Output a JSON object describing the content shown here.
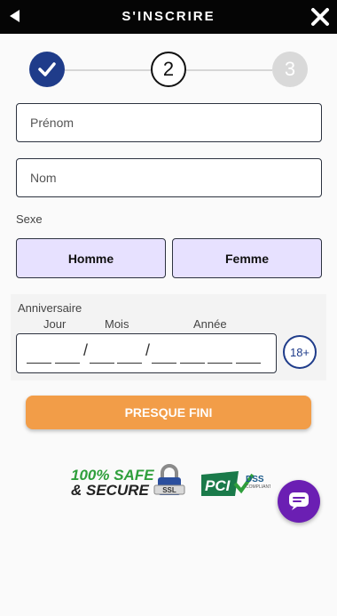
{
  "header": {
    "title": "S'INSCRIRE"
  },
  "steps": {
    "step2": "2",
    "step3": "3"
  },
  "form": {
    "first_name_placeholder": "Prénom",
    "last_name_placeholder": "Nom",
    "sex_label": "Sexe",
    "male_label": "Homme",
    "female_label": "Femme"
  },
  "birthday": {
    "label": "Anniversaire",
    "day_label": "Jour",
    "month_label": "Mois",
    "year_label": "Année",
    "separator": "/",
    "age_badge": "18+"
  },
  "cta": {
    "label": "PRESQUE FINI"
  },
  "badges": {
    "safe_line1": "100% SAFE",
    "safe_line2": "& SECURE"
  },
  "colors": {
    "primary": "#1f3c8a",
    "cta": "#f29d48",
    "gender_bg": "#e7e1ff",
    "chat": "#6b1fb3"
  }
}
